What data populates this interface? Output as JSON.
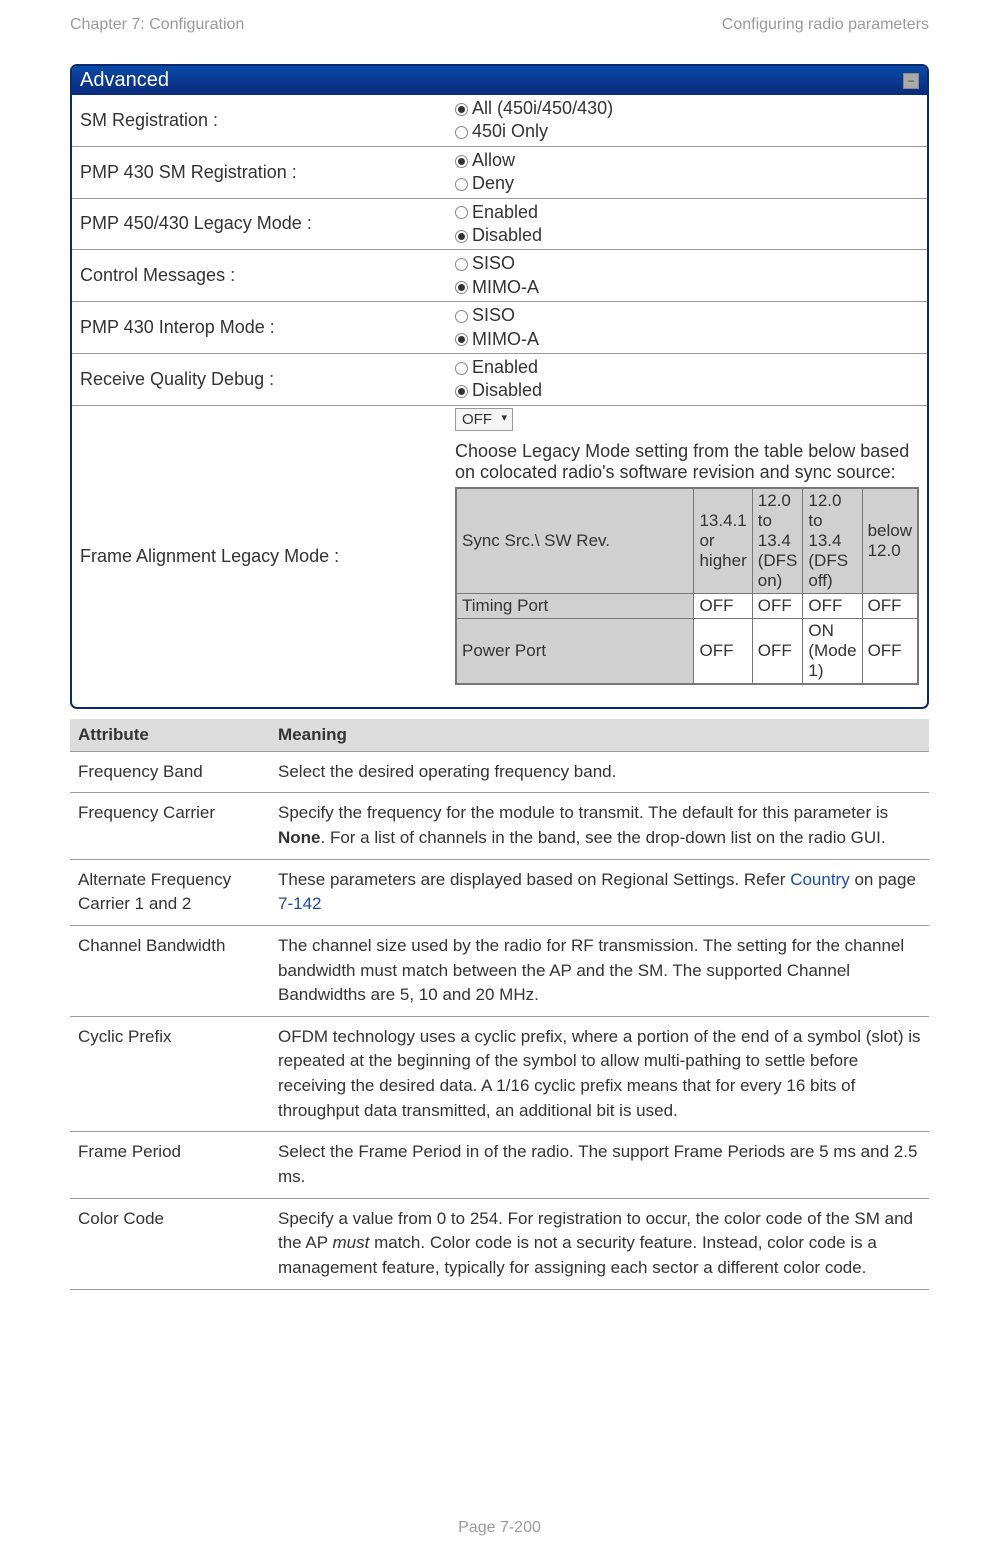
{
  "header": {
    "left": "Chapter 7:  Configuration",
    "right": "Configuring radio parameters"
  },
  "panel": {
    "title": "Advanced",
    "rows": [
      {
        "label": "SM Registration :",
        "options": [
          "All (450i/450/430)",
          "450i Only"
        ],
        "selected": 0
      },
      {
        "label": "PMP 430 SM Registration :",
        "options": [
          "Allow",
          "Deny"
        ],
        "selected": 0
      },
      {
        "label": "PMP 450/430 Legacy Mode :",
        "options": [
          "Enabled",
          "Disabled"
        ],
        "selected": 1
      },
      {
        "label": "Control Messages :",
        "options": [
          "SISO",
          "MIMO-A"
        ],
        "selected": 1
      },
      {
        "label": "PMP 430 Interop Mode :",
        "options": [
          "SISO",
          "MIMO-A"
        ],
        "selected": 1
      },
      {
        "label": "Receive Quality Debug :",
        "options": [
          "Enabled",
          "Disabled"
        ],
        "selected": 1
      }
    ],
    "legacy": {
      "label": "Frame Alignment Legacy Mode :",
      "select_value": "OFF",
      "help": "Choose Legacy Mode setting from the table below based on colocated radio's software revision and sync source:",
      "table": {
        "headers": [
          "Sync Src.\\ SW Rev.",
          "13.4.1 or higher",
          "12.0 to 13.4 (DFS on)",
          "12.0 to 13.4 (DFS off)",
          "below 12.0"
        ],
        "rows": [
          [
            "Timing Port",
            "OFF",
            "OFF",
            "OFF",
            "OFF"
          ],
          [
            "Power Port",
            "OFF",
            "OFF",
            "ON (Mode 1)",
            "OFF"
          ]
        ]
      }
    }
  },
  "attrs": {
    "header": {
      "c1": "Attribute",
      "c2": "Meaning"
    },
    "rows": [
      {
        "a": "Frequency Band",
        "m": "Select the desired operating frequency band."
      },
      {
        "a": "Frequency Carrier",
        "m_pre": "Specify the frequency for the module to transmit. The default for this parameter is ",
        "m_bold": "None",
        "m_post": ". For a list of channels in the band, see the drop-down list on the radio GUI."
      },
      {
        "a": "Alternate Frequency Carrier 1 and 2",
        "m_pre": "These parameters are displayed based on Regional Settings. Refer ",
        "m_link": "Country",
        "m_mid": " on page ",
        "m_link2": "7-142"
      },
      {
        "a": "Channel Bandwidth",
        "m": "The channel size used by the radio for RF transmission. The setting for the channel bandwidth must match between the AP and the SM. The supported Channel Bandwidths are 5, 10 and 20 MHz."
      },
      {
        "a": "Cyclic Prefix",
        "m": "OFDM technology uses a cyclic prefix, where a portion of the end of a symbol (slot) is repeated at the beginning of the symbol to allow multi-pathing to settle before receiving the desired data. A 1/16 cyclic prefix means that for every 16 bits of throughput data transmitted, an additional bit is used."
      },
      {
        "a": "Frame Period",
        "m": "Select the Frame Period in of the radio. The support Frame Periods are 5 ms and 2.5 ms."
      },
      {
        "a": "Color Code",
        "m_pre": "Specify a value from 0 to 254. For registration to occur, the color code of the SM and the AP ",
        "m_italic": "must",
        "m_post": " match. Color code is not a security feature. Instead, color code is a management feature, typically for assigning each sector a different color code."
      }
    ]
  },
  "footer": "Page 7-200"
}
